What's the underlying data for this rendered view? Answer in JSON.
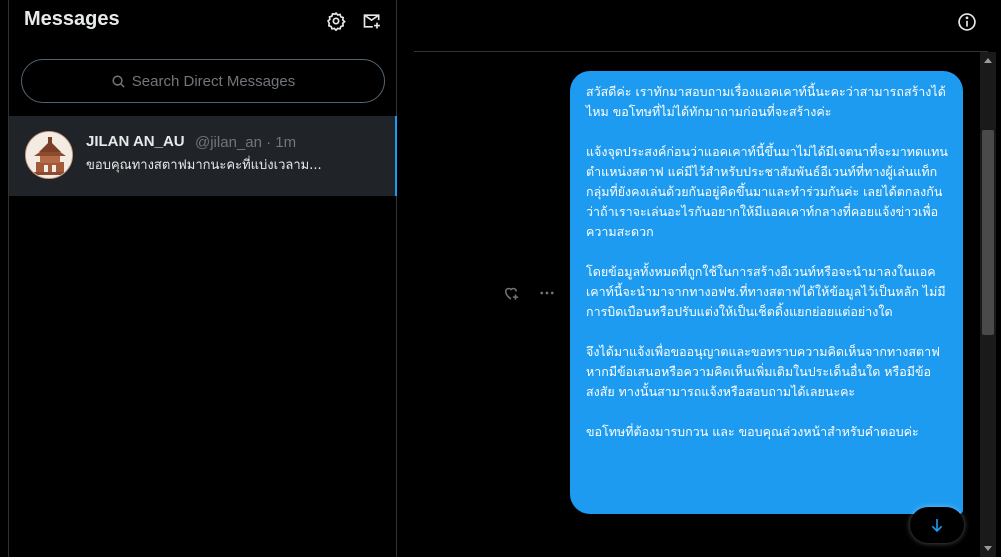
{
  "sidebar": {
    "title": "Messages",
    "search_placeholder": "Search Direct Messages",
    "conversations": [
      {
        "name": "JILAN AN_AU",
        "handle_time": "@jilan_an · 1m",
        "preview": "ขอบคุณทางสตาฟมากนะคะที่แบ่งเวลาม..."
      }
    ]
  },
  "chat": {
    "message": "สวัสดีค่ะ เราทักมาสอบถามเรื่องแอคเคาท์นี้นะคะว่าสามารถสร้างได้ไหม ขอโทษที่ไม่ได้ทักมาถามก่อนที่จะสร้างค่ะ\n\nแจ้งจุดประสงค์ก่อนว่าแอคเคาท์นี้ขึ้นมาไม่ได้มีเจตนาที่จะมาทดแทนตำแหน่งสตาฟ แค่มีไว้สำหรับประชาสัมพันธ์อีเวนท์ที่ทางผู้เล่นแท็กกลุ่มที่ยังคงเล่นด้วยกันอยู่คิดขึ้นมาและทำร่วมกันค่ะ เลยได้ตกลงกันว่าถ้าเราจะเล่นอะไรกันอยากให้มีแอคเคาท์กลางที่คอยแจ้งข่าวเพื่อความสะดวก\n\nโดยข้อมูลทั้งหมดที่ถูกใช้ในการสร้างอีเวนท์หรือจะนำมาลงในแอคเคาท์นี้จะนำมาจากทางอฟช.ที่ทางสตาฟได้ให้ข้อมูลไว้เป็นหลัก ไม่มีการบิดเบือนหรือปรับแต่งให้เป็นเช็ตดิ้งแยกย่อยแต่อย่างใด\n\nจึงได้มาแจ้งเพื่อขออนุญาตและขอทราบความคิดเห็นจากทางสตาฟ หากมีข้อเสนอหรือความคิดเห็นเพิ่มเติมในประเด็นอื่นใด หรือมีข้อสงสัย ทางนั้นสามารถแจ้งหรือสอบถามได้เลยนะคะ\n\nขอโทษที่ต้องมารบกวน และ ขอบคุณล่วงหน้าสำหรับคำตอบค่ะ"
  },
  "colors": {
    "accent": "#1d9bf0",
    "background": "#000000",
    "selected_row": "#202327",
    "muted_text": "#71767b"
  },
  "icons": {
    "settings": "gear-icon",
    "new_message": "new-message-icon",
    "search": "search-icon",
    "info": "info-icon",
    "react": "heart-plus-icon",
    "more": "more-dots-icon",
    "scroll_down": "arrow-down-icon"
  }
}
